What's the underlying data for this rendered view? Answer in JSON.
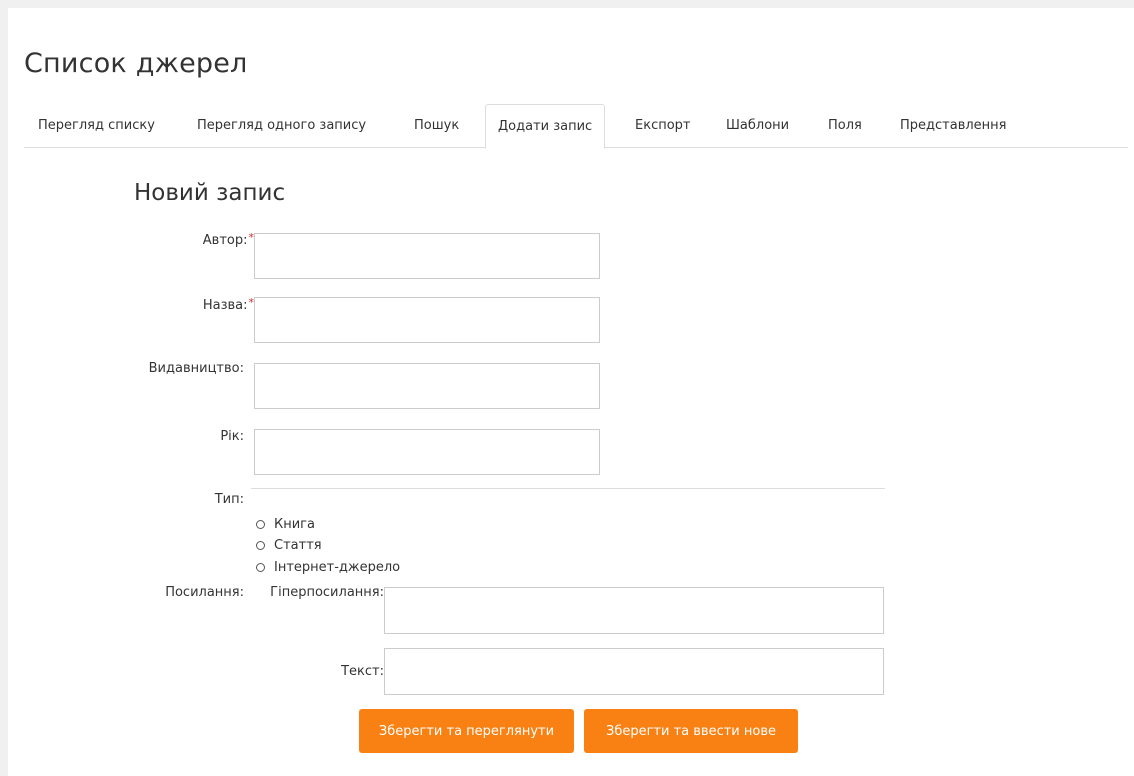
{
  "page": {
    "title": "Список джерел"
  },
  "tabs": [
    {
      "label": "Перегляд списку"
    },
    {
      "label": "Перегляд одного запису"
    },
    {
      "label": "Пошук"
    },
    {
      "label": "Додати запис",
      "active": true
    },
    {
      "label": "Експорт"
    },
    {
      "label": "Шаблони"
    },
    {
      "label": "Поля"
    },
    {
      "label": "Представлення"
    }
  ],
  "form": {
    "title": "Новий запис",
    "fields": {
      "author": {
        "label": "Автор:",
        "required": "*",
        "value": ""
      },
      "title": {
        "label": "Назва:",
        "required": "*",
        "value": ""
      },
      "publisher": {
        "label": "Видавництво:",
        "value": ""
      },
      "year": {
        "label": "Рік:",
        "value": ""
      }
    },
    "type": {
      "label": "Тип:",
      "options": [
        "Книга",
        "Стаття",
        "Інтернет-джерело"
      ],
      "selected": null
    },
    "link": {
      "label": "Посилання:",
      "hyperlink_label": "Гіперпосилання:",
      "hyperlink_value": "",
      "text_label": "Текст:",
      "text_value": ""
    },
    "buttons": {
      "save_and_view": "Зберегти та переглянути",
      "save_and_add": "Зберегти та ввести нове"
    }
  },
  "colors": {
    "accent": "#f98012",
    "required": "#c9302c",
    "border": "#cccccc",
    "background": "#f0f0f0"
  }
}
